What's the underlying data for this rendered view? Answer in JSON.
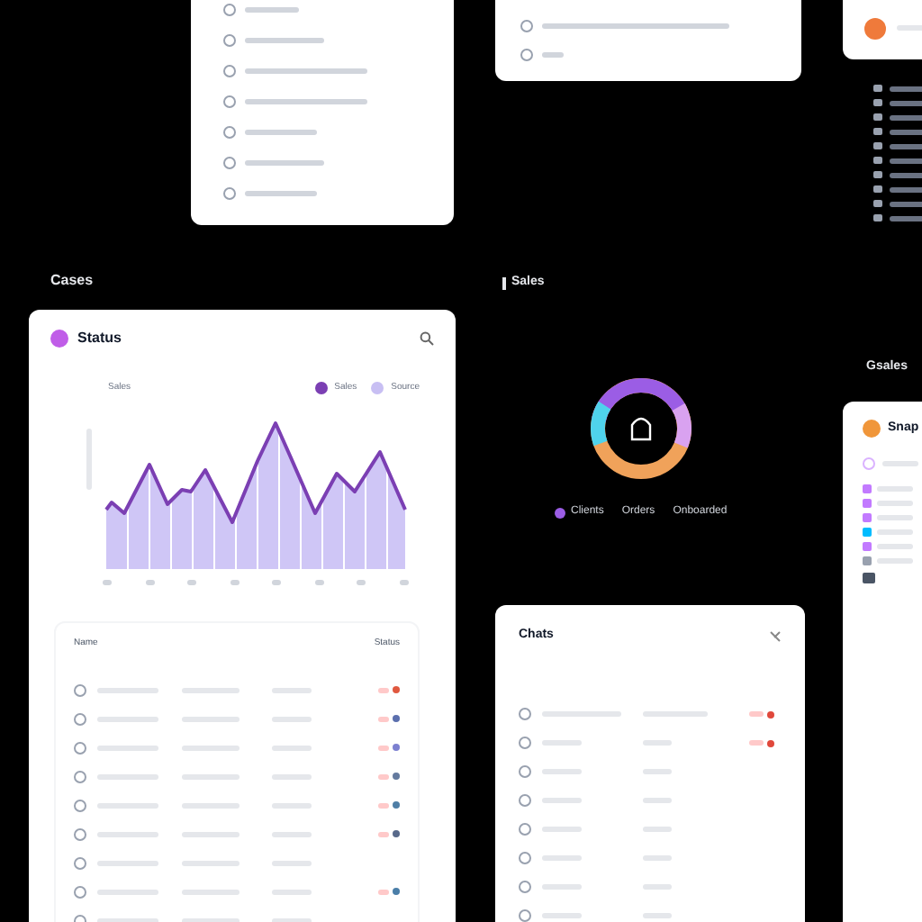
{
  "labels": {
    "left": "Cases",
    "center": "Sales",
    "right": "Gsales"
  },
  "status_card": {
    "title": "Status",
    "chart_label": "Sales",
    "legend": [
      {
        "label": "Sales",
        "color": "#7b3fb3"
      },
      {
        "label": "Source",
        "color": "#c8bff3"
      }
    ],
    "table": {
      "header_left": "Name",
      "header_right": "Status",
      "rows": [
        {
          "kind": "status",
          "color": "#e0583f"
        },
        {
          "kind": "status",
          "color": "#5b6fae"
        },
        {
          "kind": "status",
          "color": "#7c80d0"
        },
        {
          "kind": "status",
          "color": "#647a9e"
        },
        {
          "kind": "status",
          "color": "#4f7ea6"
        },
        {
          "kind": "status",
          "color": "#58698a"
        },
        {
          "kind": "plain"
        },
        {
          "kind": "status",
          "color": "#4a7ea8"
        },
        {
          "kind": "plain"
        }
      ]
    }
  },
  "donut": {
    "legend": [
      {
        "label": "Clients",
        "color": "#9b5de5"
      },
      {
        "label": "Orders"
      },
      {
        "label": "Onboarded"
      }
    ]
  },
  "chats_card": {
    "title": "Chats",
    "rows": [
      {
        "kind": "status",
        "color": "#e0483b"
      },
      {
        "kind": "status",
        "color": "#e0483b"
      },
      {
        "kind": "plain"
      },
      {
        "kind": "plain"
      },
      {
        "kind": "plain"
      },
      {
        "kind": "plain"
      },
      {
        "kind": "plain"
      },
      {
        "kind": "plain"
      }
    ]
  },
  "profile_card": {
    "title": "Snap"
  }
}
